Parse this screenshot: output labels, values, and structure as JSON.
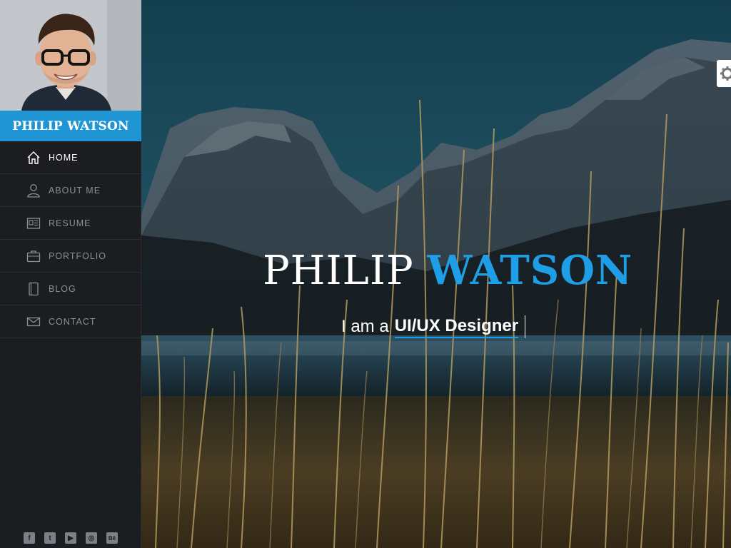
{
  "profile": {
    "name": "PHILIP WATSON",
    "photo_icon": "profile-photo"
  },
  "nav": {
    "items": [
      {
        "label": "HOME",
        "icon": "home-icon",
        "active": true
      },
      {
        "label": "ABOUT ME",
        "icon": "user-icon",
        "active": false
      },
      {
        "label": "RESUME",
        "icon": "resume-icon",
        "active": false
      },
      {
        "label": "PORTFOLIO",
        "icon": "briefcase-icon",
        "active": false
      },
      {
        "label": "BLOG",
        "icon": "book-icon",
        "active": false
      },
      {
        "label": "CONTACT",
        "icon": "envelope-icon",
        "active": false
      }
    ]
  },
  "socials": [
    {
      "name": "facebook-icon",
      "glyph": "f"
    },
    {
      "name": "twitter-icon",
      "glyph": "t"
    },
    {
      "name": "youtube-icon",
      "glyph": "▶"
    },
    {
      "name": "dribbble-icon",
      "glyph": "◎"
    },
    {
      "name": "behance-icon",
      "glyph": "Bē"
    }
  ],
  "hero": {
    "title_first": "PHILIP",
    "title_last": "WATSON",
    "subtitle_prefix": "I am a",
    "subtitle_role": "UI/UX Designer"
  },
  "settings": {
    "icon": "gear-icon"
  },
  "colors": {
    "accent": "#1d9ee6",
    "banner": "#1f95d3",
    "sidebar_bg": "#1b1d21",
    "nav_text": "#8c8f95",
    "nav_text_active": "#ffffff"
  }
}
